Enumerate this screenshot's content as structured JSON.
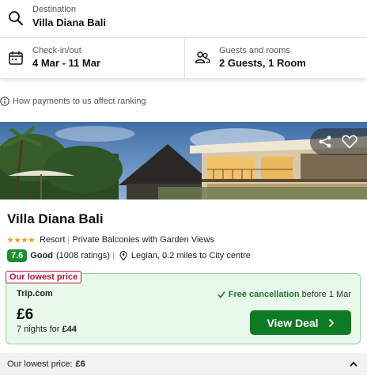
{
  "search": {
    "destination_label": "Destination",
    "destination_value": "Villa Diana Bali",
    "dates_label": "Check-in/out",
    "dates_value": "4 Mar - 11 Mar",
    "guests_label": "Guests and rooms",
    "guests_value": "2 Guests, 1 Room"
  },
  "ranking_note": "How payments to us affect ranking",
  "hotel": {
    "name": "Villa Diana Bali",
    "star_count": 4,
    "type": "Resort",
    "feature": "Private Balconies with Garden Views",
    "score": "7.6",
    "rating_word": "Good",
    "ratings_count": "(1008 ratings)",
    "location": "Legian, 0.2 miles to City centre"
  },
  "deal": {
    "tag": "Our lowest price",
    "provider": "Trip.com",
    "free_cancel_strong": "Free cancellation",
    "free_cancel_rest": "before 1 Mar",
    "price": "£6",
    "nights_prefix": "7 nights for",
    "nights_total": "£44",
    "button_label": "View Deal"
  },
  "bottom": {
    "label": "Our lowest price:",
    "price": "£6"
  },
  "colors": {
    "score_green": "#1a8f2e",
    "button_green": "#0e7a23",
    "deal_bg": "#e8f8ea",
    "lowest_tag_red": "#b3123a"
  }
}
